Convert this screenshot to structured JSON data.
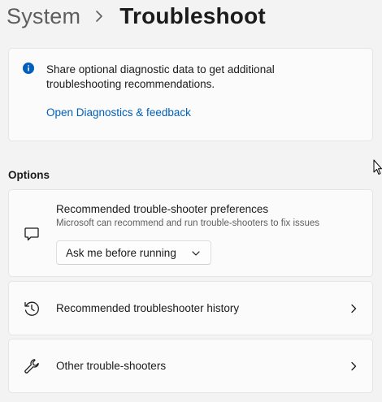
{
  "breadcrumb": {
    "parent": "System",
    "current": "Troubleshoot"
  },
  "info": {
    "text": "Share optional diagnostic data to get additional troubleshooting recommendations.",
    "link": "Open Diagnostics & feedback",
    "icon": "info-icon",
    "icon_color": "#005fb8"
  },
  "options": {
    "heading": "Options",
    "preferences": {
      "title": "Recommended trouble-shooter preferences",
      "subtitle": "Microsoft can recommend and run trouble-shooters to fix issues",
      "selected": "Ask me before running",
      "icon": "chat-bubble-icon"
    },
    "history": {
      "title": "Recommended troubleshooter history",
      "icon": "history-icon"
    },
    "other": {
      "title": "Other trouble-shooters",
      "icon": "wrench-icon"
    }
  },
  "colors": {
    "background": "#f3f3f3",
    "card": "#fbfbfb",
    "link": "#005fb8",
    "text": "#1b1b1b",
    "secondary_text": "#5f5f5f"
  }
}
